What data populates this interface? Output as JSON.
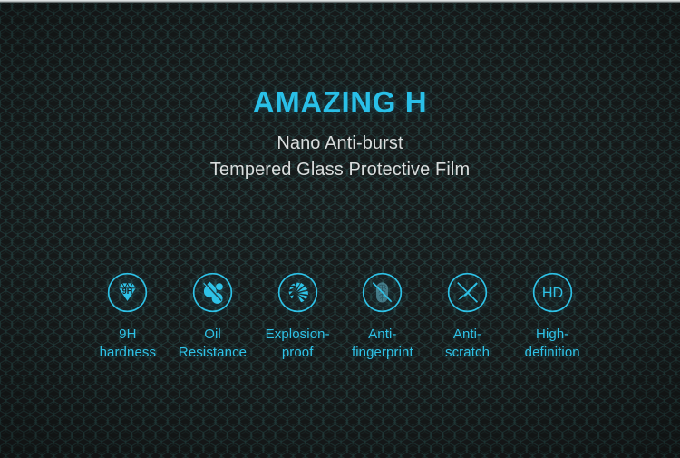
{
  "banner": {
    "headline": "AMAZING H",
    "subline_line1": "Nano Anti-burst",
    "subline_line2": "Tempered Glass Protective Film",
    "accent_color": "#29c0e8",
    "subtitle_color": "#d9dddd",
    "background_color": "#191c1d",
    "hex_line_color": "#24403f"
  },
  "features": [
    {
      "icon": "diamond-9h-icon",
      "label": "9H\nhardness",
      "label_line1": "9H",
      "label_line2": "hardness"
    },
    {
      "icon": "oil-droplet-repel-icon",
      "label": "Oil\nResistance",
      "label_line1": "Oil",
      "label_line2": "Resistance"
    },
    {
      "icon": "shatter-shards-icon",
      "label": "Explosion-\nproof",
      "label_line1": "Explosion-",
      "label_line2": "proof"
    },
    {
      "icon": "fingerprint-prohibited-icon",
      "label": "Anti-\nfingerprint",
      "label_line1": "Anti-",
      "label_line2": "fingerprint"
    },
    {
      "icon": "knife-prohibited-icon",
      "label": "Anti-\nscratch",
      "label_line1": "Anti-",
      "label_line2": "scratch"
    },
    {
      "icon": "hd-badge-icon",
      "label": "High-\ndefinition",
      "label_line1": "High-",
      "label_line2": "definition"
    }
  ]
}
